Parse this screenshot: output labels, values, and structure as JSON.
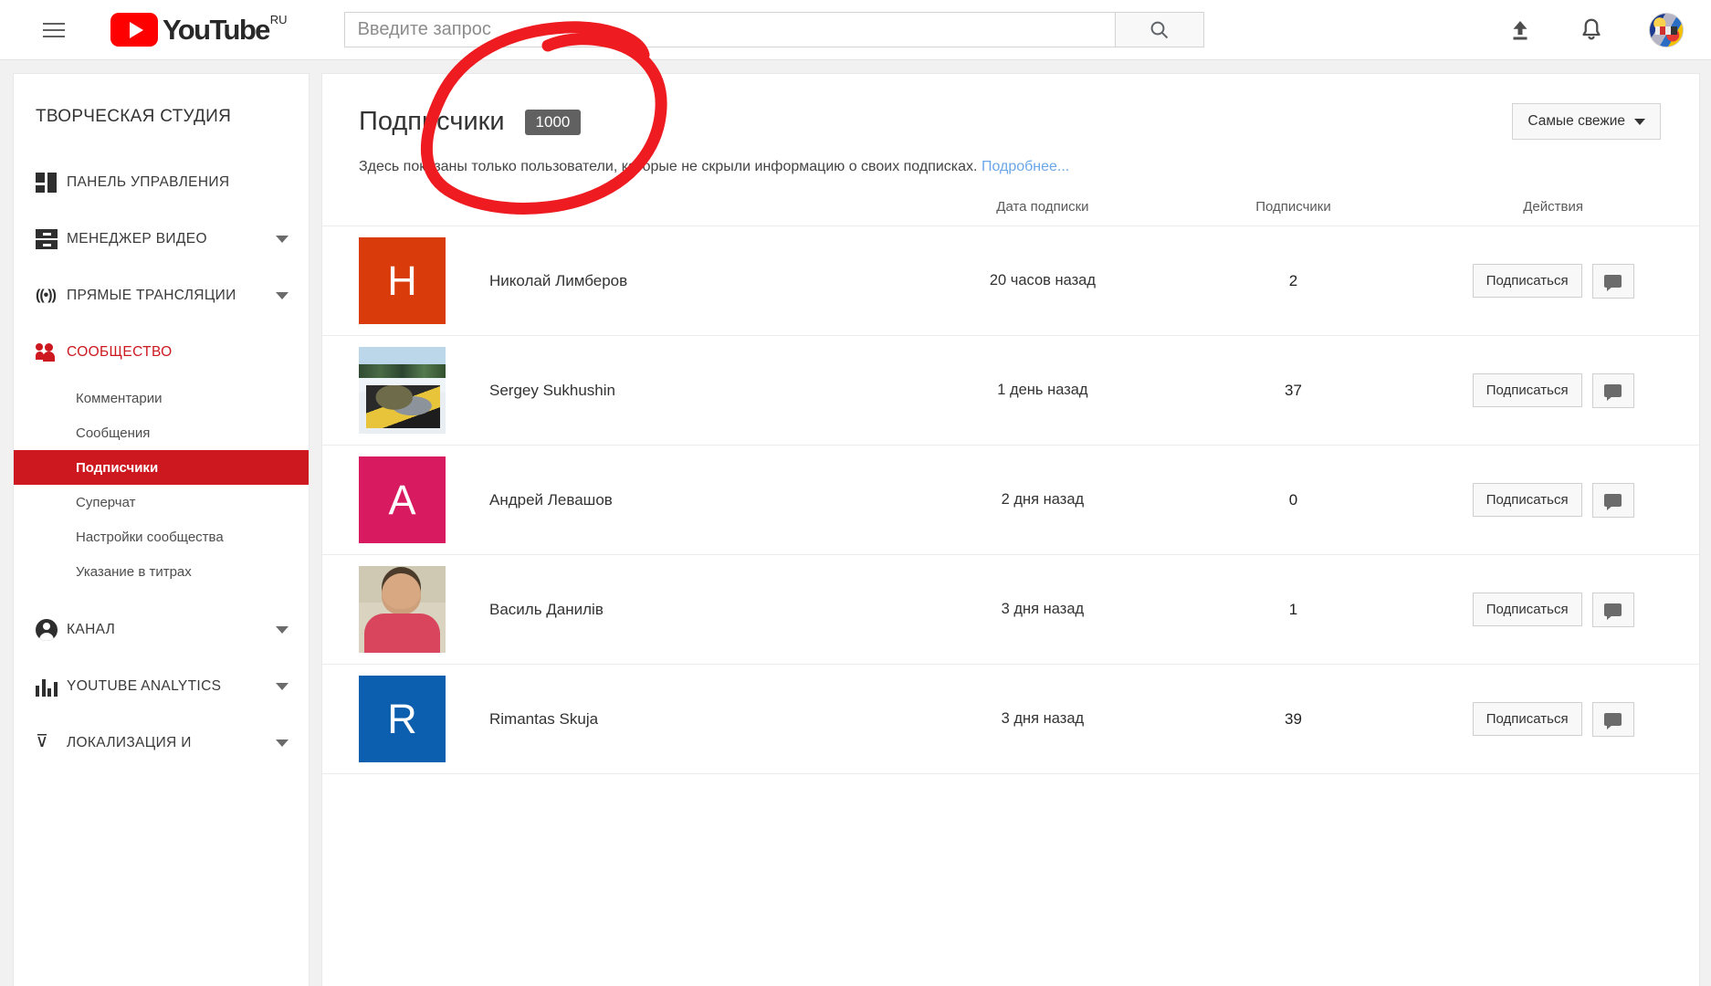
{
  "header": {
    "menu_icon": "hamburger-menu-icon",
    "logo_text": "YouTube",
    "logo_country": "RU",
    "search_placeholder": "Введите запрос",
    "search_value": "",
    "search_icon": "search-icon",
    "upload_icon": "upload-icon",
    "notifications_icon": "bell-icon",
    "avatar": "account-avatar"
  },
  "sidebar": {
    "title": "ТВОРЧЕСКАЯ СТУДИЯ",
    "items": [
      {
        "label": "ПАНЕЛЬ УПРАВЛЕНИЯ",
        "icon": "dashboard-icon",
        "expandable": false
      },
      {
        "label": "МЕНЕДЖЕР ВИДЕО",
        "icon": "video-manager-icon",
        "expandable": true
      },
      {
        "label": "ПРЯМЫЕ ТРАНСЛЯЦИИ",
        "icon": "live-stream-icon",
        "expandable": true
      },
      {
        "label": "СООБЩЕСТВО",
        "icon": "community-icon",
        "expandable": false,
        "active": true
      },
      {
        "label": "КАНАЛ",
        "icon": "channel-icon",
        "expandable": true
      },
      {
        "label": "YOUTUBE ANALYTICS",
        "icon": "analytics-icon",
        "expandable": true
      },
      {
        "label": "ЛОКАЛИЗАЦИЯ И",
        "icon": "localization-icon",
        "expandable": true
      }
    ],
    "sub_items": [
      {
        "label": "Комментарии",
        "selected": false
      },
      {
        "label": "Сообщения",
        "selected": false
      },
      {
        "label": "Подписчики",
        "selected": true
      },
      {
        "label": "Суперчат",
        "selected": false
      },
      {
        "label": "Настройки сообщества",
        "selected": false
      },
      {
        "label": "Указание в титрах",
        "selected": false
      }
    ],
    "active_color": "#cc181e"
  },
  "main": {
    "title": "Подписчики",
    "count_badge": "1000",
    "sort_label": "Самые свежие",
    "subtitle": "Здесь показаны только пользователи, которые не скрыли информацию о своих подписках.",
    "subtitle_link": "Подробнее...",
    "columns": {
      "user": "",
      "date": "Дата подписки",
      "subscribers": "Подписчики",
      "actions": "Действия"
    },
    "rows": [
      {
        "name": "Николай Лимберов",
        "avatar_type": "letter",
        "avatar_letter": "Н",
        "avatar_color": "#d93b0b",
        "date": "20 часов назад",
        "subscribers": "2",
        "subscribe_label": "Подписаться",
        "message_icon": "message-icon"
      },
      {
        "name": "Sergey Sukhushin",
        "avatar_type": "photo-snow",
        "avatar_letter": "",
        "avatar_color": "",
        "date": "1 день назад",
        "subscribers": "37",
        "subscribe_label": "Подписаться",
        "message_icon": "message-icon"
      },
      {
        "name": "Андрей Левашов",
        "avatar_type": "letter",
        "avatar_letter": "А",
        "avatar_color": "#d81b60",
        "date": "2 дня назад",
        "subscribers": "0",
        "subscribe_label": "Подписаться",
        "message_icon": "message-icon"
      },
      {
        "name": "Василь Данилів",
        "avatar_type": "photo-man",
        "avatar_letter": "",
        "avatar_color": "",
        "date": "3 дня назад",
        "subscribers": "1",
        "subscribe_label": "Подписаться",
        "message_icon": "message-icon"
      },
      {
        "name": "Rimantas Skuja",
        "avatar_type": "letter",
        "avatar_letter": "R",
        "avatar_color": "#0b5fae",
        "date": "3 дня назад",
        "subscribers": "39",
        "subscribe_label": "Подписаться",
        "message_icon": "message-icon"
      }
    ]
  },
  "annotation": {
    "shape": "hand-drawn-circle",
    "color": "#ee1c20",
    "target": "count_badge"
  }
}
